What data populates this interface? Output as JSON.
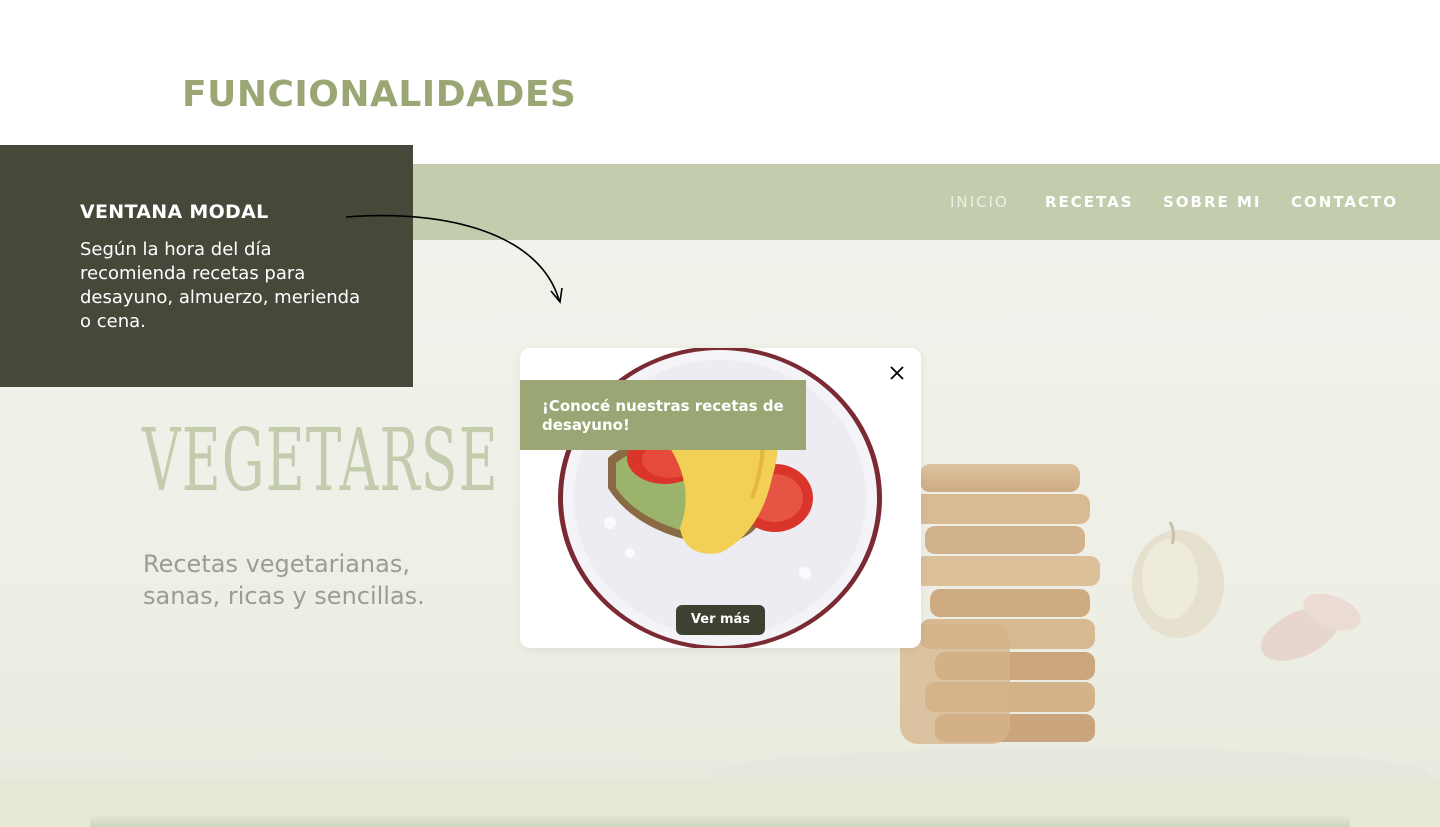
{
  "section": {
    "title": "FUNCIONALIDADES"
  },
  "annotation": {
    "title": "VENTANA MODAL",
    "text": "Según la hora del día recomienda recetas para desayuno, almuerzo, merienda o cena."
  },
  "nav": {
    "items": [
      {
        "label": "INICIO",
        "active": true
      },
      {
        "label": "RECETAS",
        "active": false
      },
      {
        "label": "SOBRE MI",
        "active": false
      },
      {
        "label": "CONTACTO",
        "active": false
      }
    ]
  },
  "hero": {
    "brand": "VEGETARSE",
    "subtitle": "Recetas vegetarianas, sanas, ricas y sencillas."
  },
  "modal": {
    "banner": "¡Conocé nuestras recetas de desayuno!",
    "button_label": "Ver más",
    "close_icon": "close-icon"
  },
  "colors": {
    "accent": "#9aa774",
    "nav_bg": "#c4ccae",
    "annotation_bg": "#46493a",
    "button_bg": "#3d4132"
  }
}
